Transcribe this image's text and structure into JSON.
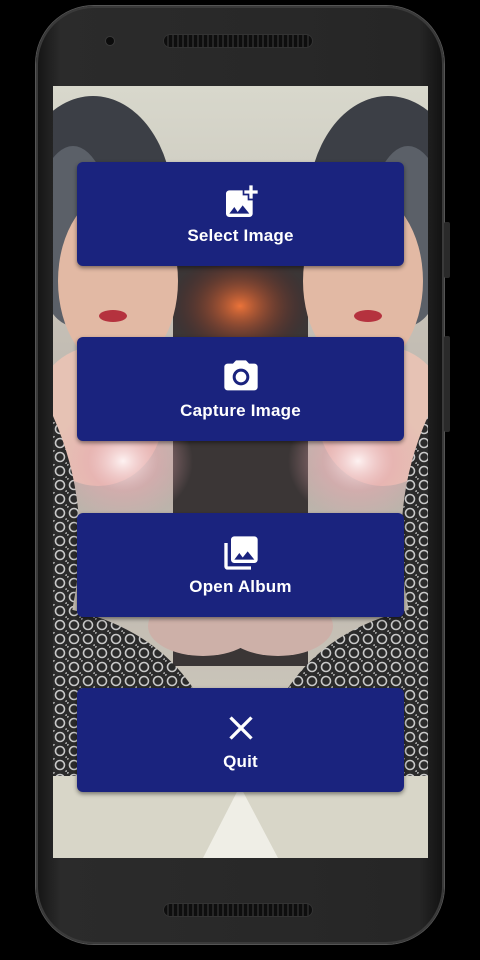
{
  "menu": {
    "select_image": {
      "label": "Select Image",
      "icon": "add-photo-icon"
    },
    "capture_image": {
      "label": "Capture Image",
      "icon": "camera-icon"
    },
    "open_album": {
      "label": "Open Album",
      "icon": "photo-library-icon"
    },
    "quit": {
      "label": "Quit",
      "icon": "close-icon"
    }
  },
  "colors": {
    "button": "#1a237e",
    "button_text": "#ffffff",
    "device_frame": "#262626",
    "page_background": "#000000"
  }
}
